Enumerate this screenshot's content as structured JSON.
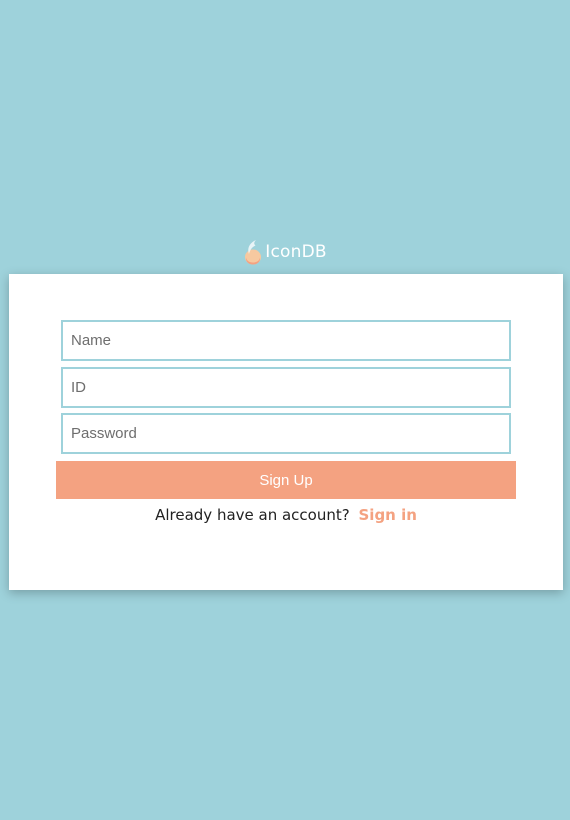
{
  "brand": {
    "name": "IconDB",
    "logo_icon": "droplet-logo-icon"
  },
  "form": {
    "name_placeholder": "Name",
    "id_placeholder": "ID",
    "password_placeholder": "Password",
    "submit_label": "Sign Up",
    "footer_text": "Already have an account?",
    "signin_link_label": "Sign in"
  },
  "colors": {
    "background": "#9ed2db",
    "accent": "#f4a281",
    "field_border": "#9ed2db"
  }
}
